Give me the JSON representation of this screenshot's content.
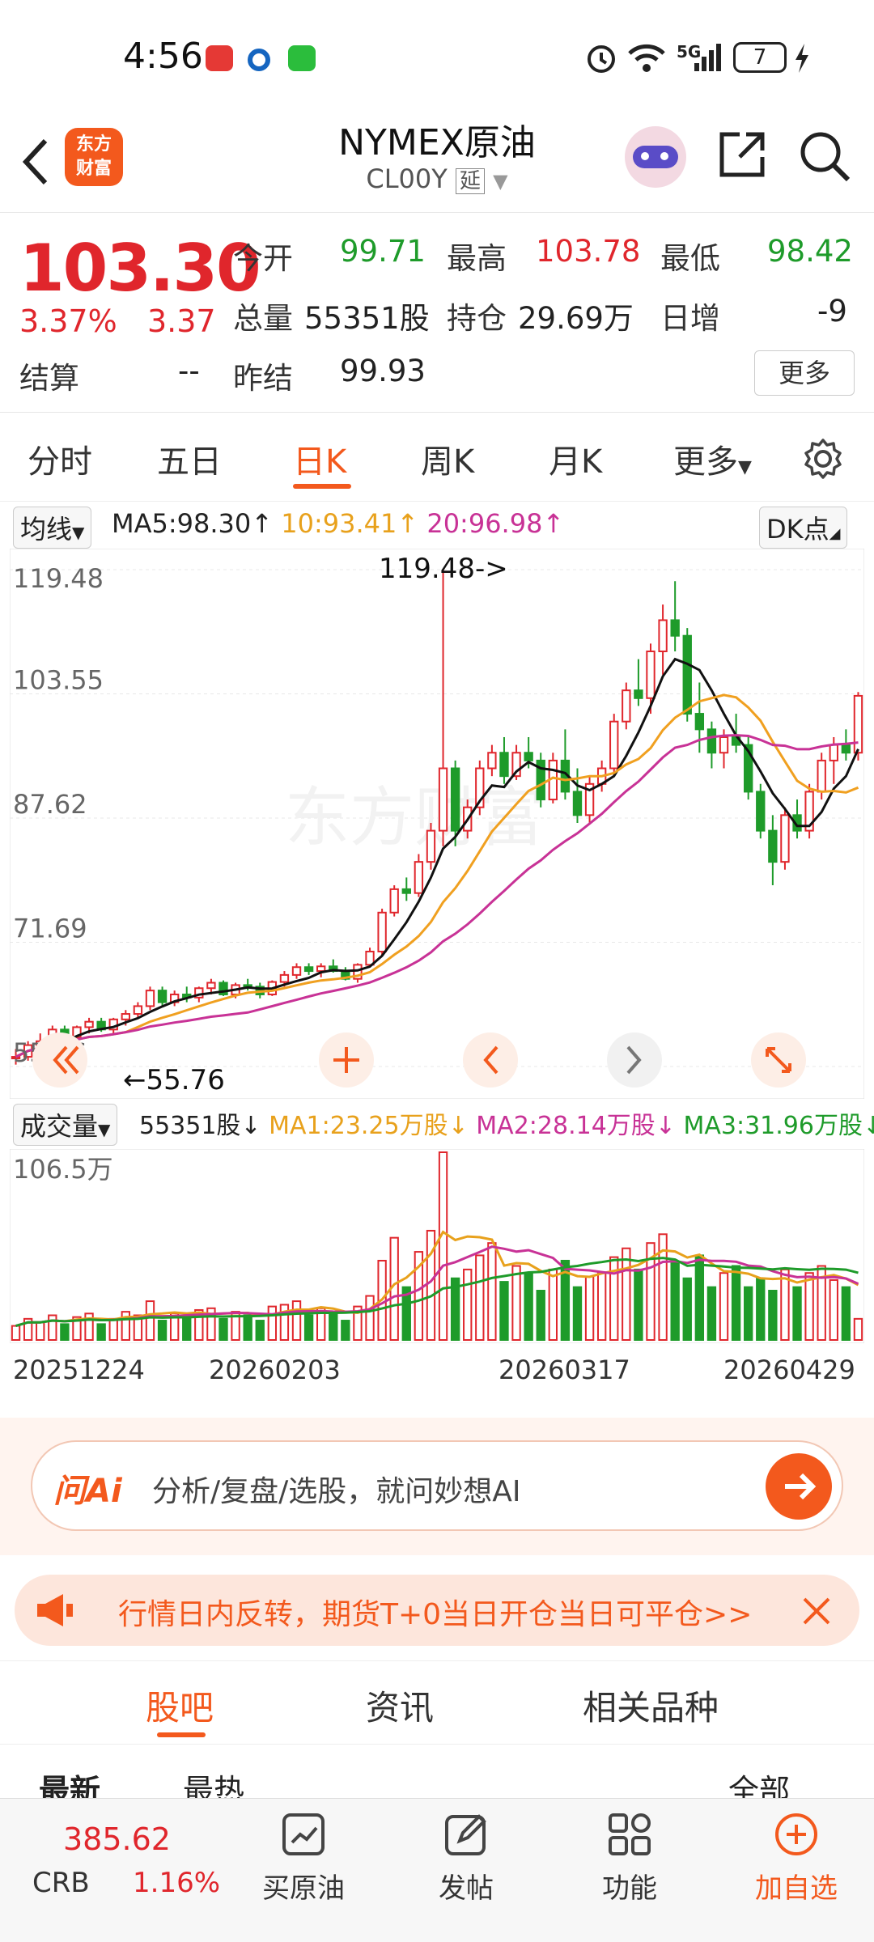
{
  "status_bar": {
    "time": "4:56",
    "network": "5G",
    "battery": "7"
  },
  "header": {
    "logo_text": "东方财富",
    "title": "NYMEX原油",
    "code": "CL00Y",
    "delay_badge": "延"
  },
  "quote": {
    "price": "103.30",
    "change_pct": "3.37%",
    "change": "3.37",
    "open_label": "今开",
    "open": "99.71",
    "high_label": "最高",
    "high": "103.78",
    "low_label": "最低",
    "low": "98.42",
    "volume_label": "总量",
    "volume": "55351股",
    "oi_label": "持仓",
    "oi": "29.69万",
    "daily_inc_label": "日增",
    "daily_inc": "-9",
    "settle_label": "结算",
    "settle": "--",
    "prev_settle_label": "昨结",
    "prev_settle": "99.93",
    "more_button": "更多"
  },
  "period_tabs": [
    "分时",
    "五日",
    "日K",
    "周K",
    "月K",
    "更多"
  ],
  "active_tab": "日K",
  "kline": {
    "indicator_label": "均线",
    "ma5": "MA5:98.30↑",
    "ma10": "10:93.41↑",
    "ma20": "20:96.98↑",
    "dk_button": "DK点",
    "y_ticks": [
      "119.48",
      "103.55",
      "87.62",
      "71.69",
      "55.76"
    ],
    "max_marker": "119.48->",
    "min_marker": "←55.76",
    "watermark": "东方财富",
    "colors": {
      "up": "#e0262c",
      "down": "#1e9b2a",
      "ma5": "#111111",
      "ma10": "#f0a020",
      "ma20": "#c83296"
    }
  },
  "volume_panel": {
    "indicator_label": "成交量",
    "volume": "55351股↓",
    "ma1": "MA1:23.25万股↓",
    "ma2": "MA2:28.14万股↓",
    "ma3": "MA3:31.96万股↓",
    "y_top": "106.5万",
    "dates": [
      "20251224",
      "20260203",
      "20260317",
      "20260429"
    ]
  },
  "chart_data": {
    "type": "candlestick",
    "ylim": [
      55.76,
      119.48
    ],
    "ohlc": [
      [
        57,
        58,
        56,
        57
      ],
      [
        57,
        59,
        56.5,
        58.5
      ],
      [
        58.5,
        60,
        57.5,
        59
      ],
      [
        59,
        61,
        58.5,
        60.5
      ],
      [
        60.5,
        61,
        59,
        59.5
      ],
      [
        59.5,
        61,
        59,
        60.8
      ],
      [
        60.8,
        62,
        60,
        61.5
      ],
      [
        61.5,
        62,
        60.2,
        60.5
      ],
      [
        60.5,
        62,
        60,
        61.8
      ],
      [
        61.8,
        63,
        61,
        62.5
      ],
      [
        62.5,
        64,
        62,
        63.5
      ],
      [
        63.5,
        66,
        63,
        65.5
      ],
      [
        65.5,
        66,
        63.5,
        64
      ],
      [
        64,
        65.5,
        63.5,
        65
      ],
      [
        65,
        66,
        64,
        64.6
      ],
      [
        64.6,
        66,
        64,
        65.8
      ],
      [
        65.8,
        67,
        65,
        66.5
      ],
      [
        66.5,
        66.8,
        64.8,
        65
      ],
      [
        65,
        66.5,
        64.5,
        66.2
      ],
      [
        66.2,
        67,
        65.5,
        66
      ],
      [
        66,
        66.5,
        64.5,
        65
      ],
      [
        65,
        66.8,
        64.8,
        66.6
      ],
      [
        66.6,
        68,
        66,
        67.5
      ],
      [
        67.5,
        69,
        67,
        68.5
      ],
      [
        68.5,
        69,
        67.5,
        68
      ],
      [
        68,
        69,
        67.2,
        68.6
      ],
      [
        68.6,
        69.5,
        67.8,
        68
      ],
      [
        68,
        68.5,
        66.8,
        67
      ],
      [
        67,
        69,
        66.5,
        68.8
      ],
      [
        68.8,
        71,
        68.5,
        70.5
      ],
      [
        70.5,
        76,
        70,
        75.5
      ],
      [
        75.5,
        79,
        75,
        78.5
      ],
      [
        78.5,
        80,
        77,
        78
      ],
      [
        78,
        83,
        77.5,
        82
      ],
      [
        82,
        87,
        81,
        86
      ],
      [
        86,
        119.48,
        84,
        94
      ],
      [
        94,
        95,
        84,
        86
      ],
      [
        86,
        90,
        85,
        89
      ],
      [
        89,
        95,
        88,
        94
      ],
      [
        94,
        97,
        93,
        96
      ],
      [
        96,
        98,
        92,
        93
      ],
      [
        93,
        97,
        92.5,
        96
      ],
      [
        96,
        98,
        94,
        95
      ],
      [
        95,
        96,
        89,
        90
      ],
      [
        90,
        96,
        89.5,
        95
      ],
      [
        95,
        99,
        90,
        91
      ],
      [
        91,
        94,
        87,
        88
      ],
      [
        88,
        93,
        87,
        92
      ],
      [
        92,
        95,
        91,
        94
      ],
      [
        94,
        101,
        93,
        100
      ],
      [
        100,
        105,
        99,
        104
      ],
      [
        104,
        108,
        102,
        103
      ],
      [
        103,
        110,
        101,
        109
      ],
      [
        109,
        115,
        106,
        113
      ],
      [
        113,
        118,
        109,
        111
      ],
      [
        111,
        112,
        100,
        101
      ],
      [
        101,
        105,
        96,
        99
      ],
      [
        99,
        100,
        94,
        96
      ],
      [
        96,
        99,
        94,
        98
      ],
      [
        98,
        101,
        96,
        97
      ],
      [
        97,
        98,
        90,
        91
      ],
      [
        91,
        92,
        85,
        86
      ],
      [
        86,
        88,
        79,
        82
      ],
      [
        82,
        89,
        81,
        88
      ],
      [
        88,
        90,
        85,
        86
      ],
      [
        86,
        92,
        85,
        91
      ],
      [
        91,
        96,
        90,
        95
      ],
      [
        95,
        98,
        92,
        97
      ],
      [
        97,
        99,
        95,
        96
      ],
      [
        96,
        103.78,
        95,
        103.3
      ]
    ],
    "volume": [
      8,
      12,
      10,
      14,
      9,
      13,
      15,
      9,
      12,
      16,
      14,
      22,
      11,
      15,
      13,
      17,
      18,
      12,
      16,
      14,
      11,
      19,
      20,
      22,
      14,
      18,
      15,
      11,
      19,
      25,
      45,
      58,
      30,
      50,
      62,
      106.5,
      35,
      40,
      48,
      55,
      33,
      42,
      38,
      28,
      40,
      45,
      30,
      36,
      38,
      47,
      52,
      40,
      55,
      60,
      44,
      35,
      48,
      30,
      38,
      42,
      30,
      35,
      28,
      40,
      30,
      38,
      42,
      34,
      30,
      12
    ]
  },
  "ai_bar": {
    "logo": "问Ai",
    "placeholder": "分析/复盘/选股，就问妙想AI"
  },
  "notice": {
    "text": "行情日内反转，期货T+0当日开仓当日可平仓>>"
  },
  "section_tabs": [
    "股吧",
    "资讯",
    "相关品种"
  ],
  "sub_tabs": [
    "最新",
    "最热",
    "全部"
  ],
  "footer": {
    "crb_value": "385.62",
    "crb_label": "CRB",
    "crb_change": "1.16%",
    "buttons": [
      "买原油",
      "发帖",
      "功能",
      "加自选"
    ]
  }
}
